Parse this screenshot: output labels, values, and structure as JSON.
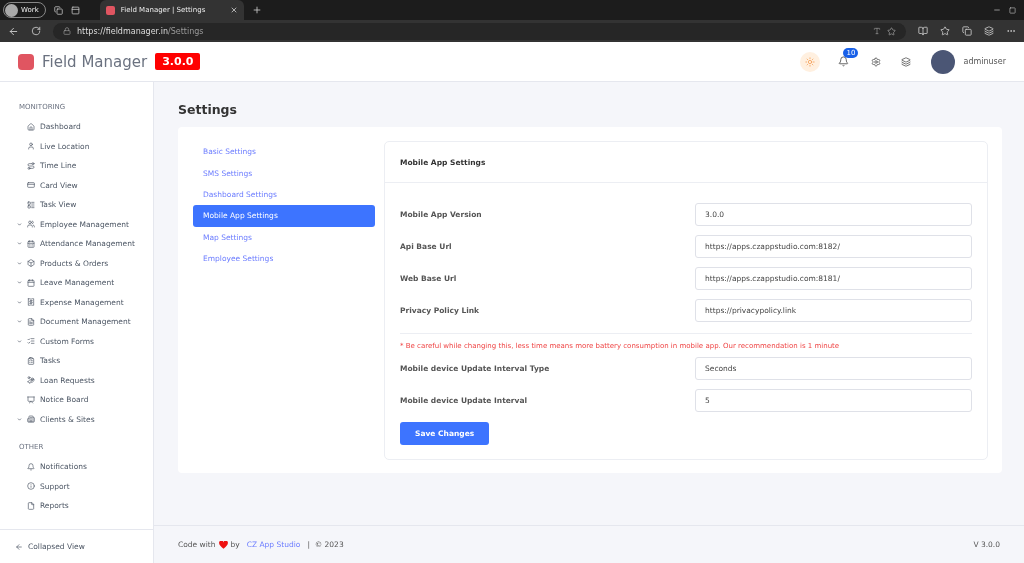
{
  "browser": {
    "profile": "Work",
    "tab_title": "Field Manager | Settings",
    "url_host": "https://fieldmanager.in",
    "url_path": "/Settings"
  },
  "header": {
    "brand": "Field Manager",
    "version_badge": "3.0.0",
    "notification_count": "10",
    "username": "adminuser"
  },
  "sidebar": {
    "sections": [
      {
        "heading": "MONITORING",
        "items": [
          {
            "label": "Dashboard",
            "kind": "link"
          },
          {
            "label": "Live Location",
            "kind": "link"
          },
          {
            "label": "Time Line",
            "kind": "link"
          },
          {
            "label": "Card View",
            "kind": "link"
          },
          {
            "label": "Task View",
            "kind": "link"
          },
          {
            "label": "Employee Management",
            "kind": "group"
          },
          {
            "label": "Attendance Management",
            "kind": "group"
          },
          {
            "label": "Products & Orders",
            "kind": "group"
          },
          {
            "label": "Leave Management",
            "kind": "group"
          },
          {
            "label": "Expense Management",
            "kind": "group"
          },
          {
            "label": "Document Management",
            "kind": "group"
          },
          {
            "label": "Custom Forms",
            "kind": "group"
          },
          {
            "label": "Tasks",
            "kind": "link"
          },
          {
            "label": "Loan Requests",
            "kind": "link"
          },
          {
            "label": "Notice Board",
            "kind": "link"
          },
          {
            "label": "Clients & Sites",
            "kind": "group"
          }
        ]
      },
      {
        "heading": "OTHER",
        "items": [
          {
            "label": "Notifications",
            "kind": "link"
          },
          {
            "label": "Support",
            "kind": "link"
          },
          {
            "label": "Reports",
            "kind": "link"
          }
        ]
      }
    ],
    "collapse_label": "Collapsed View"
  },
  "page_title": "Settings",
  "settings_menu": [
    {
      "label": "Basic Settings",
      "selected": false
    },
    {
      "label": "SMS Settings",
      "selected": false
    },
    {
      "label": "Dashboard Settings",
      "selected": false
    },
    {
      "label": "Mobile App Settings",
      "selected": true
    },
    {
      "label": "Map Settings",
      "selected": false
    },
    {
      "label": "Employee Settings",
      "selected": false
    }
  ],
  "panel": {
    "title": "Mobile App Settings",
    "fields": [
      {
        "label": "Mobile App Version",
        "value": "3.0.0"
      },
      {
        "label": "Api Base Url",
        "value": "https://apps.czappstudio.com:8182/"
      },
      {
        "label": "Web Base Url",
        "value": "https://apps.czappstudio.com:8181/"
      },
      {
        "label": "Privacy Policy Link",
        "value": "https://privacypolicy.link"
      }
    ],
    "warning": "* Be careful while changing this, less time means more battery consumption in mobile app. Our recommendation is 1 minute",
    "interval_fields": [
      {
        "label": "Mobile device Update Interval Type",
        "value": "Seconds"
      },
      {
        "label": "Mobile device Update Interval",
        "value": "5"
      }
    ],
    "save_button": "Save Changes"
  },
  "footer": {
    "prefix": "Code with",
    "by": "by",
    "studio_link": "CZ App Studio",
    "copyright": "|  © 2023",
    "version": "V 3.0.0"
  }
}
